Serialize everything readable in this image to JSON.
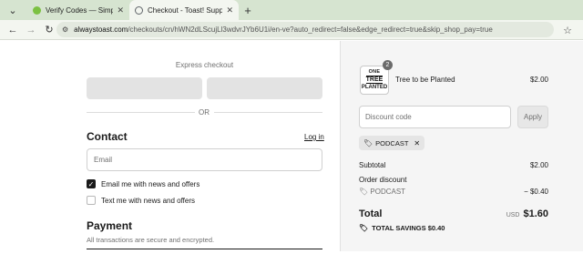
{
  "browser": {
    "tabs": [
      {
        "title": "Verify Codes — SimplyCodes",
        "favicon_color": "#7cc142",
        "active": false
      },
      {
        "title": "Checkout - Toast! Supplements",
        "favicon_color": "#5f6368",
        "active": true
      }
    ],
    "url_host": "alwaystoast.com",
    "url_path": "/checkouts/cn/hWN2dLScujLl3wdvrJYb6U1i/en-ve?auto_redirect=false&edge_redirect=true&skip_shop_pay=true"
  },
  "checkout": {
    "express_label": "Express checkout",
    "or_label": "OR",
    "contact_heading": "Contact",
    "login_link": "Log in",
    "email_placeholder": "Email",
    "opt_news_email": "Email me with news and offers",
    "opt_news_text": "Text me with news and offers",
    "opt_news_email_checked": true,
    "opt_news_text_checked": false,
    "payment_heading": "Payment",
    "payment_sub": "All transactions are secure and encrypted."
  },
  "summary": {
    "item": {
      "thumb_line1": "ONE",
      "thumb_line2": "TREE",
      "thumb_line3": "PLANTED",
      "quantity": "2",
      "name": "Tree to be Planted",
      "price": "$2.00"
    },
    "discount_placeholder": "Discount code",
    "apply_label": "Apply",
    "applied_code": "PODCAST",
    "subtotal_label": "Subtotal",
    "subtotal_value": "$2.00",
    "order_discount_label": "Order discount",
    "discount_code_label": "PODCAST",
    "discount_value": "− $0.40",
    "total_label": "Total",
    "total_currency": "USD",
    "total_value": "$1.60",
    "savings_label": "TOTAL SAVINGS",
    "savings_value": "$0.40"
  }
}
